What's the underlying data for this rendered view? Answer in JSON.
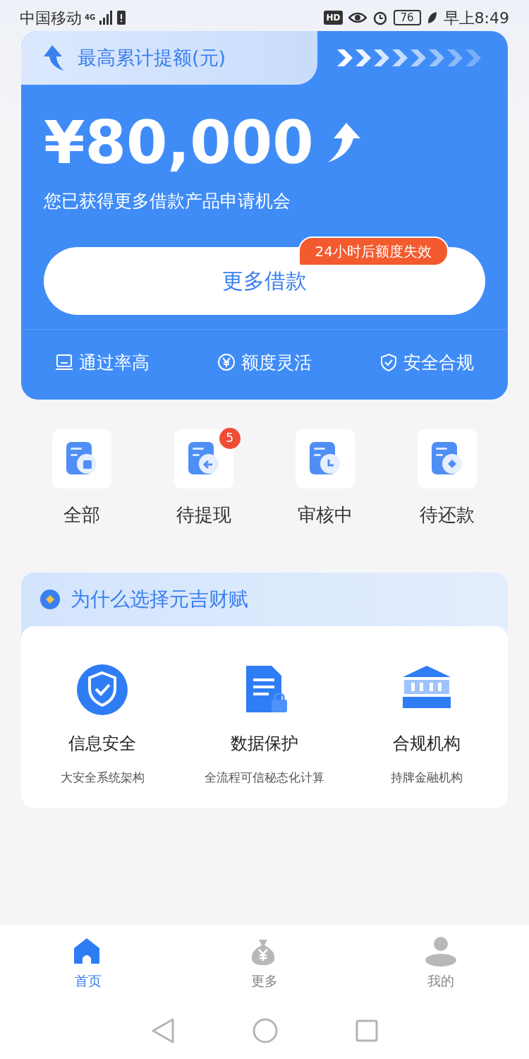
{
  "status_bar": {
    "carrier": "中国移动",
    "network": "4G",
    "hd": "HD",
    "battery": "76",
    "time": "早上8:49"
  },
  "quota_card": {
    "title": "最高累计提额(元)",
    "amount": "¥80,000",
    "subtitle": "您已获得更多借款产品申请机会",
    "button": "更多借款",
    "badge": "24小时后额度失效",
    "features": [
      {
        "label": "通过率高",
        "kind": "laptop"
      },
      {
        "label": "额度灵活",
        "kind": "yen"
      },
      {
        "label": "安全合规",
        "kind": "shield"
      }
    ]
  },
  "shortcuts": [
    {
      "label": "全部",
      "kind": "square"
    },
    {
      "label": "待提现",
      "kind": "arrow",
      "badge": "5"
    },
    {
      "label": "审核中",
      "kind": "clock"
    },
    {
      "label": "待还款",
      "kind": "diamond"
    }
  ],
  "why": {
    "title": "为什么选择元吉财赋",
    "items": [
      {
        "title": "信息安全",
        "subtitle": "大安全系统架构",
        "kind": "shield"
      },
      {
        "title": "数据保护",
        "subtitle": "全流程可信秘态化计算",
        "kind": "document"
      },
      {
        "title": "合规机构",
        "subtitle": "持牌金融机构",
        "kind": "bank"
      }
    ]
  },
  "tabs": [
    {
      "label": "首页",
      "kind": "home",
      "selected": true
    },
    {
      "label": "更多",
      "kind": "bag",
      "selected": false
    },
    {
      "label": "我的",
      "kind": "user",
      "selected": false
    }
  ]
}
